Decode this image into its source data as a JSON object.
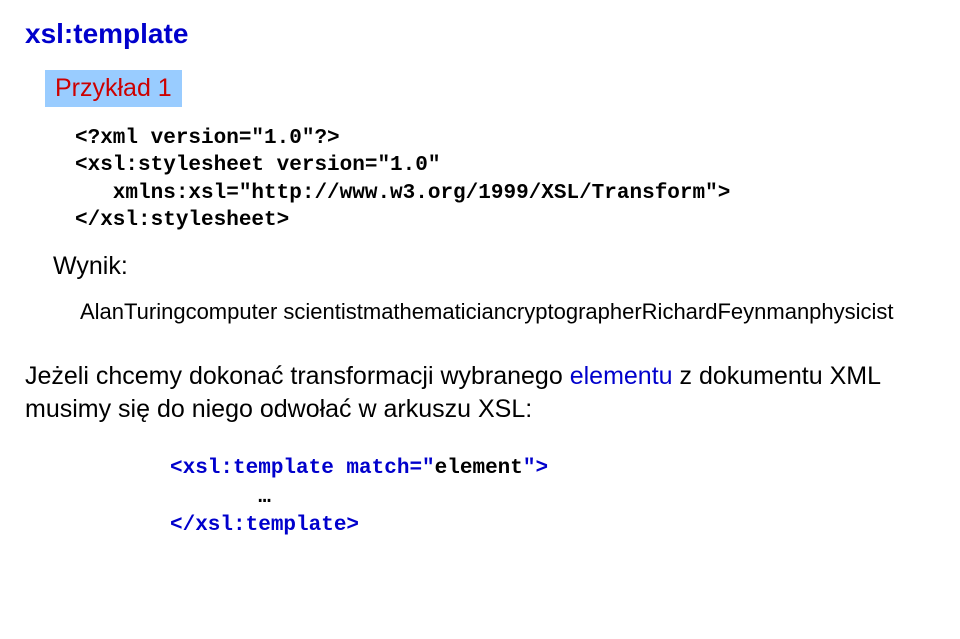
{
  "title": "xsl:template",
  "exampleLabel": "Przykład 1",
  "code": {
    "line1": "<?xml version=\"1.0\"?>",
    "line2": "<xsl:stylesheet version=\"1.0\"",
    "line3": "   xmlns:xsl=\"http://www.w3.org/1999/XSL/Transform\">",
    "line4": "</xsl:stylesheet>"
  },
  "resultLabel": "Wynik:",
  "resultText": "AlanTuringcomputer scientistmathematiciancryptographerRichardFeynmanphysicist",
  "paragraph": {
    "part1": "Jeżeli chcemy dokonać transformacji wybranego ",
    "element": "elementu",
    "part2": " z dokumentu XML musimy się do niego odwołać w arkuszu XSL:"
  },
  "snippet": {
    "openTag": "<xsl:template match=\"",
    "matchValue": "element",
    "openTagEnd": "\">",
    "ellipsis": "…",
    "closeTag": "</xsl:template>"
  }
}
